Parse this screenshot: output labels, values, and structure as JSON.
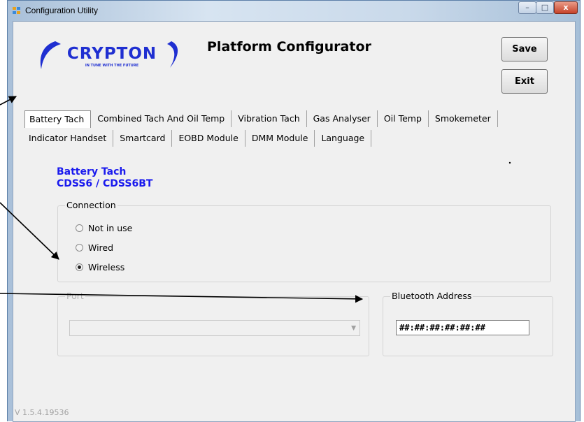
{
  "window": {
    "title": "Configuration Utility",
    "min_label": "–",
    "max_label": "□",
    "close_label": "x"
  },
  "logo": {
    "brand": "CRYPTON",
    "tagline": "IN TUNE WITH THE FUTURE",
    "brand_color": "#1f2fd1"
  },
  "header": {
    "title": "Platform Configurator"
  },
  "buttons": {
    "save": "Save",
    "exit": "Exit"
  },
  "tabs": {
    "row1": [
      "Battery Tach",
      "Combined Tach And Oil Temp",
      "Vibration Tach",
      "Gas Analyser",
      "Oil Temp",
      "Smokemeter"
    ],
    "row2": [
      "Indicator Handset",
      "Smartcard",
      "EOBD Module",
      "DMM Module",
      "Language"
    ],
    "active": "Battery Tach"
  },
  "section": {
    "title": "Battery Tach",
    "subtitle": "CDSS6 / CDSS6BT",
    "color": "#1a1aee"
  },
  "connection": {
    "legend": "Connection",
    "options": [
      "Not in use",
      "Wired",
      "Wireless"
    ],
    "selected": "Wireless"
  },
  "port": {
    "legend": "Port",
    "value": "",
    "enabled": false
  },
  "bluetooth": {
    "legend": "Bluetooth Address",
    "value": "##:##:##:##:##:##"
  },
  "footer": {
    "version": "V 1.5.4.19536"
  }
}
